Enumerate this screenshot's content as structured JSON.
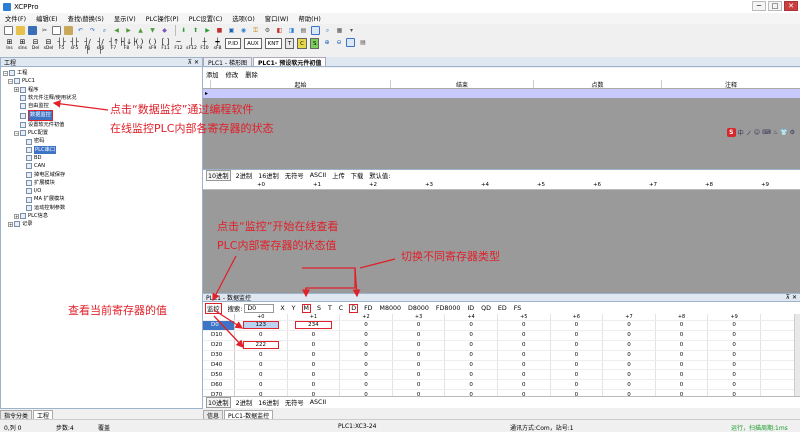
{
  "window": {
    "title": "XCPPro",
    "minimize": "─",
    "maximize": "□",
    "close": "✕"
  },
  "menu": [
    "文件(F)",
    "编辑(E)",
    "查找\\替换(S)",
    "显示(V)",
    "PLC操作(P)",
    "PLC设置(C)",
    "选项(O)",
    "窗口(W)",
    "帮助(H)"
  ],
  "toolbar2_labels": [
    "Ins",
    "sIns",
    "Del",
    "sDel",
    "F5",
    "sF5",
    "F6",
    "sF6",
    "F7",
    "F8",
    "F9",
    "sF9",
    "F11",
    "F12",
    "sF12",
    "F10",
    "sF8"
  ],
  "toolbar2_boxes": [
    "P.ID",
    "AUX",
    "KNT",
    "T",
    "C",
    "S"
  ],
  "left_panel": {
    "title": "工程",
    "tree": [
      {
        "label": "工程",
        "level": 0
      },
      {
        "label": "PLC1",
        "level": 1
      },
      {
        "label": "程序",
        "level": 2
      },
      {
        "label": "软元件注释/使用状况",
        "level": 2
      },
      {
        "label": "自由监控",
        "level": 2
      },
      {
        "label": "数据监控",
        "level": 2,
        "selected": true
      },
      {
        "label": "设置软元件初值",
        "level": 2
      },
      {
        "label": "PLC配置",
        "level": 2
      },
      {
        "label": "密码",
        "level": 3
      },
      {
        "label": "PLC串口",
        "level": 3,
        "selected": true
      },
      {
        "label": "BD",
        "level": 3
      },
      {
        "label": "CAN",
        "level": 3
      },
      {
        "label": "掉电区域保存",
        "level": 3
      },
      {
        "label": "扩展模块",
        "level": 3
      },
      {
        "label": "I/O",
        "level": 3
      },
      {
        "label": "MA 扩展模块",
        "level": 3
      },
      {
        "label": "运动控制参数",
        "level": 3
      },
      {
        "label": "PLC信息",
        "level": 2
      },
      {
        "label": "记录",
        "level": 1
      }
    ],
    "bottom_tabs": [
      "指令分类",
      "工程"
    ]
  },
  "doc_tabs": [
    "PLC1 - 梯形图",
    "PLC1- 预设软元件初值"
  ],
  "preset": {
    "actions": [
      "添加",
      "修改",
      "删除"
    ],
    "columns": [
      "起始",
      "结束",
      "点数",
      "注释"
    ]
  },
  "ime_bar": {
    "logo": "S",
    "items": [
      "中",
      "ノ",
      "☺",
      "⌨",
      "♨",
      "👕",
      "⚙"
    ]
  },
  "radix_bar": [
    "10进制",
    "2进制",
    "16进制",
    "无符号",
    "ASCII",
    "上传",
    "下载",
    "默认值:"
  ],
  "offset_cols": [
    "+0",
    "+1",
    "+2",
    "+3",
    "+4",
    "+5",
    "+6",
    "+7",
    "+8",
    "+9"
  ],
  "monitor": {
    "title": "PLC1 - 数据监控",
    "monitor_btn": "监控",
    "search_label": "搜索:",
    "search_value": "D0",
    "types": [
      "X",
      "Y",
      "M",
      "S",
      "T",
      "C",
      "D",
      "FD",
      "M8000",
      "D8000",
      "FD8000",
      "ID",
      "QD",
      "ED",
      "FS"
    ],
    "rows": [
      {
        "label": "D0",
        "values": [
          "123",
          "234",
          "0",
          "0",
          "0",
          "0",
          "0",
          "0",
          "0",
          "0"
        ]
      },
      {
        "label": "D10",
        "values": [
          "0",
          "0",
          "0",
          "0",
          "0",
          "0",
          "0",
          "0",
          "0",
          "0"
        ]
      },
      {
        "label": "D20",
        "values": [
          "222",
          "0",
          "0",
          "0",
          "0",
          "0",
          "0",
          "0",
          "0",
          "0"
        ]
      },
      {
        "label": "D30",
        "values": [
          "0",
          "0",
          "0",
          "0",
          "0",
          "0",
          "0",
          "0",
          "0",
          "0"
        ]
      },
      {
        "label": "D40",
        "values": [
          "0",
          "0",
          "0",
          "0",
          "0",
          "0",
          "0",
          "0",
          "0",
          "0"
        ]
      },
      {
        "label": "D50",
        "values": [
          "0",
          "0",
          "0",
          "0",
          "0",
          "0",
          "0",
          "0",
          "0",
          "0"
        ]
      },
      {
        "label": "D60",
        "values": [
          "0",
          "0",
          "0",
          "0",
          "0",
          "0",
          "0",
          "0",
          "0",
          "0"
        ]
      },
      {
        "label": "D70",
        "values": [
          "0",
          "0",
          "0",
          "0",
          "0",
          "0",
          "0",
          "0",
          "0",
          "0"
        ]
      }
    ],
    "radix_bottom": [
      "10进制",
      "2进制",
      "16进制",
      "无符号",
      "ASCII"
    ]
  },
  "info_tabs": [
    "信息",
    "PLC1-数据监控"
  ],
  "status": {
    "position": "0,列 0",
    "steps": "步数:4",
    "mode": "覆盖",
    "plc": "PLC1:XC3-24",
    "comm": "通讯方式:Com，站号:1",
    "run": "运行，扫描周期:1ms"
  },
  "annotations": {
    "a1_line1": "点击“数据监控”通过编程软件",
    "a1_line2": "在线监控PLC内部各寄存器的状态",
    "a2_line1": "点击“监控”开始在线查看",
    "a2_line2": "PLC内部寄存器的状态值",
    "a3": "切换不同寄存器类型",
    "a4": "查看当前寄存器的值"
  },
  "colors": {
    "annotation": "#e0202a",
    "selection": "#3d74c6",
    "preset_row": "#c8c9ff",
    "gray_area": "#9a9a9a"
  }
}
